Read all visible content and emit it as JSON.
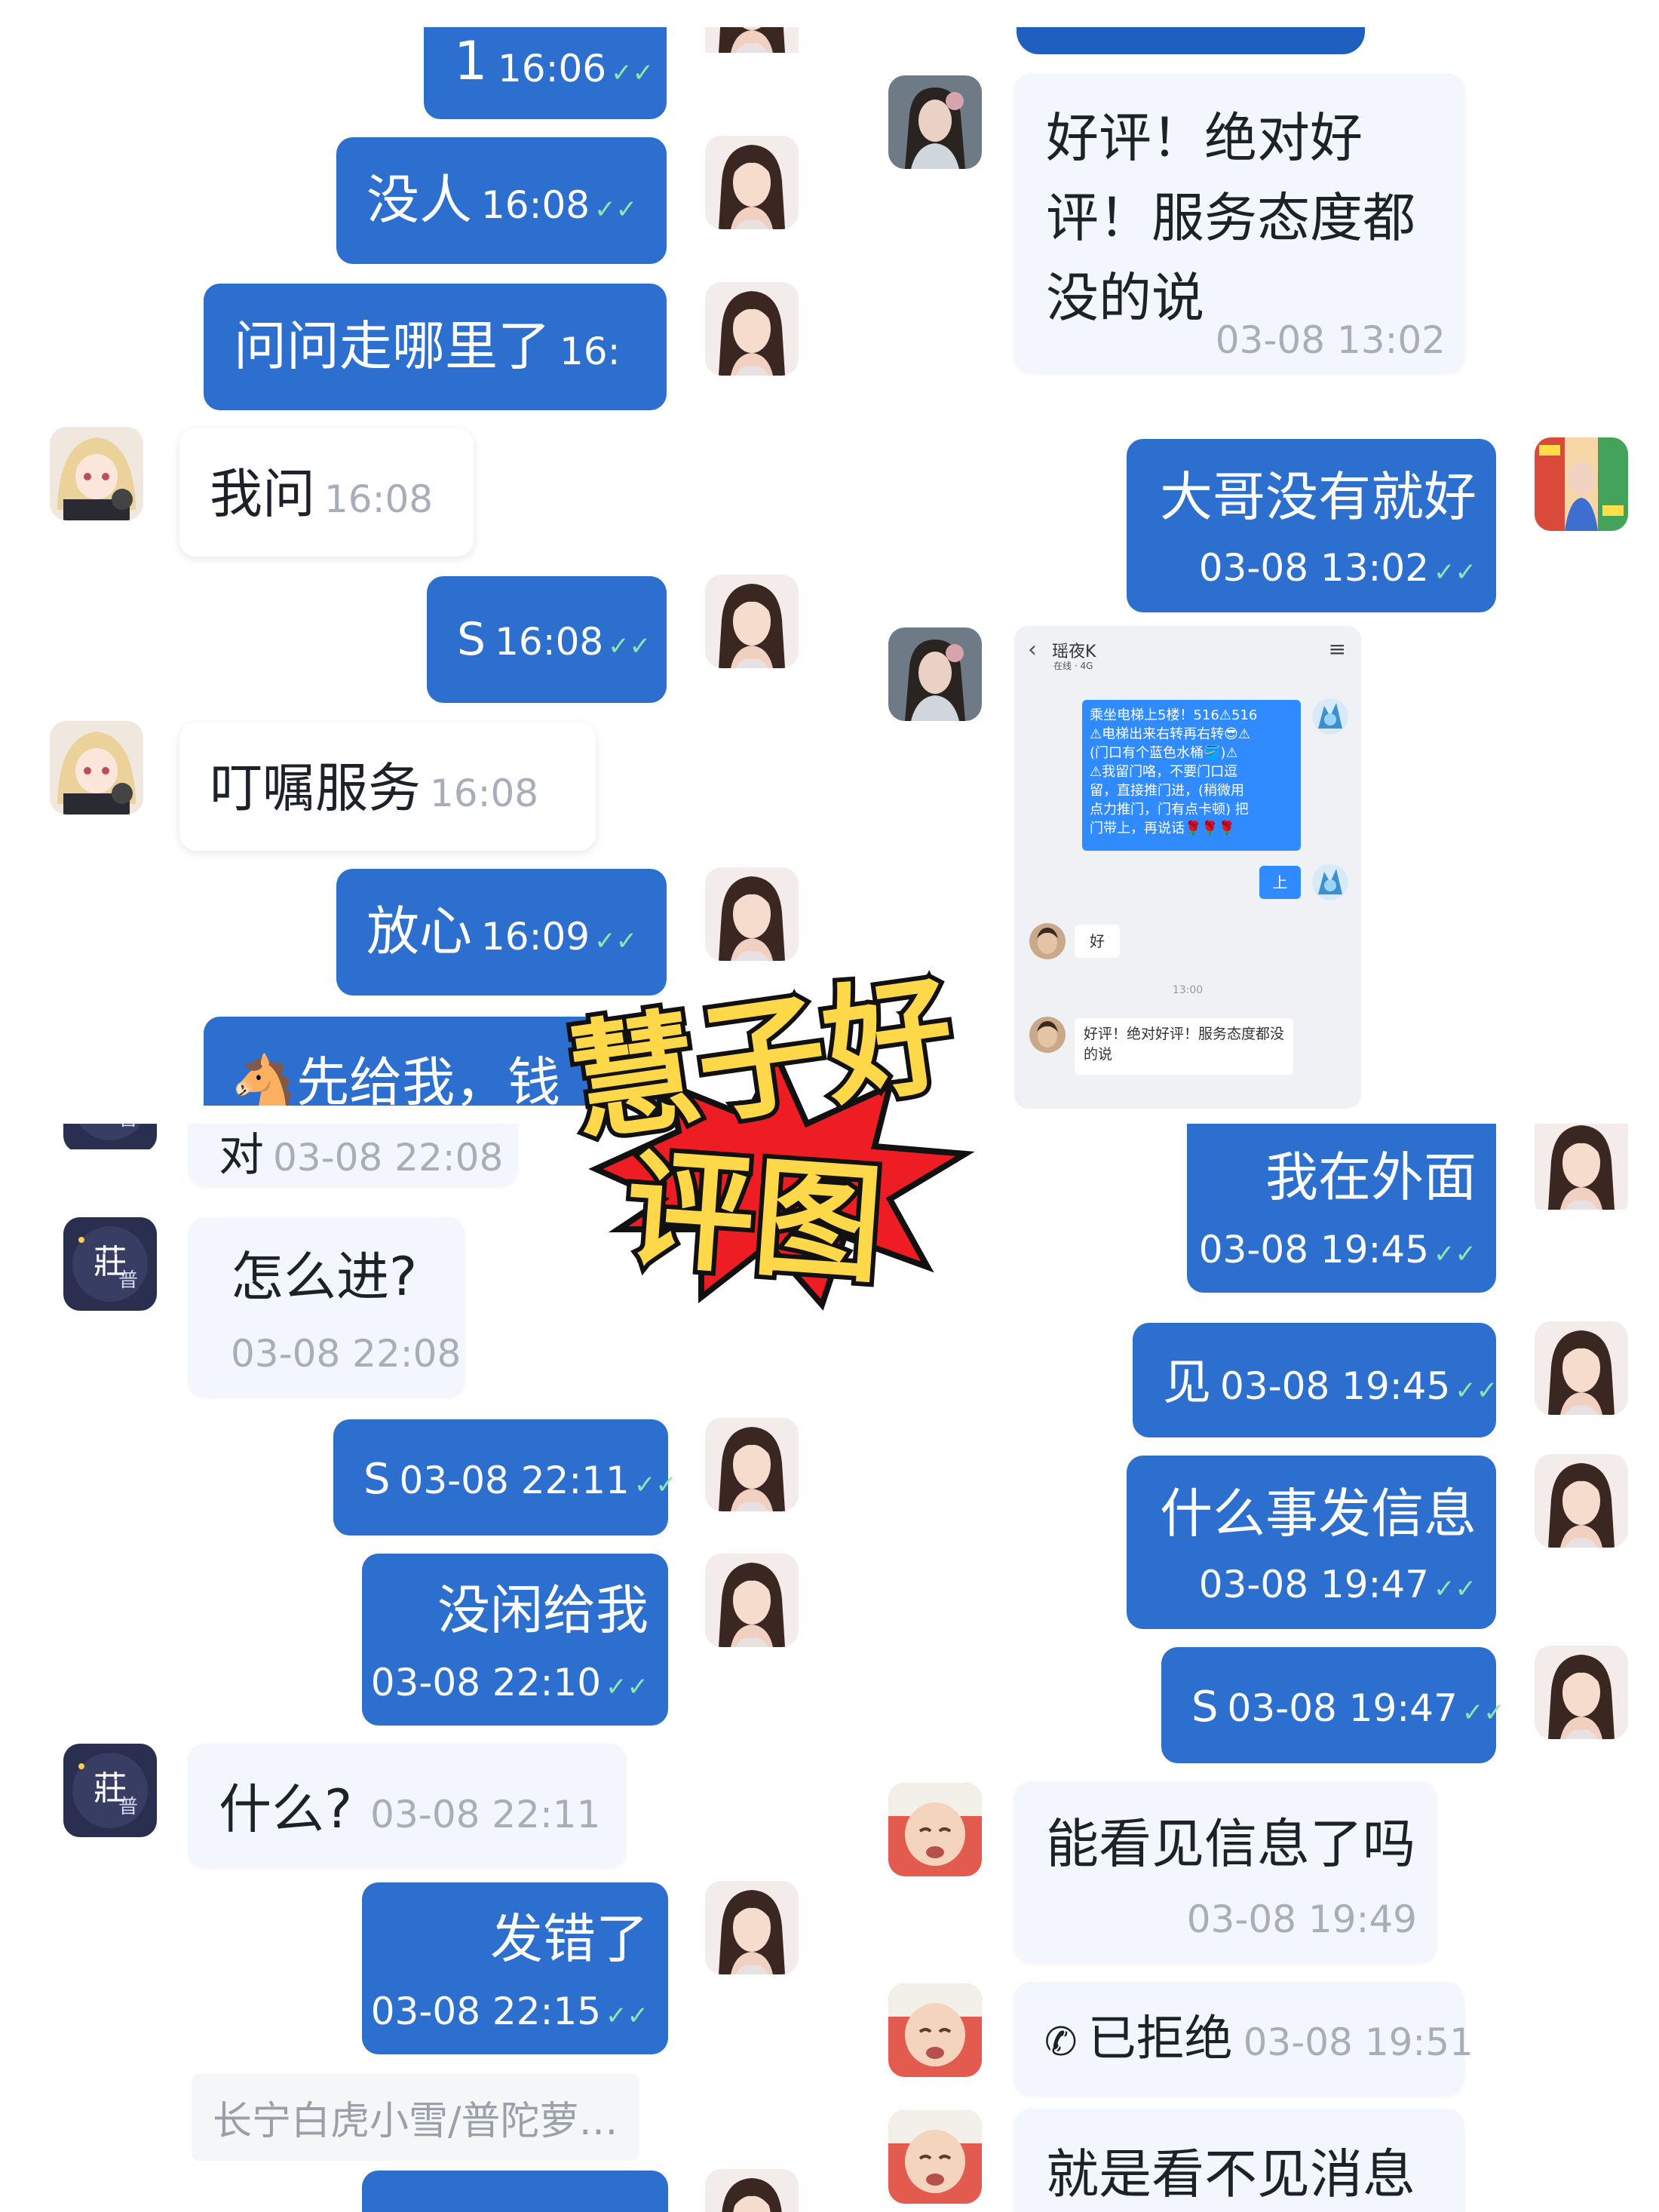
{
  "overlay": {
    "line1": "慧子好",
    "line2": "评图"
  },
  "top_left": {
    "messages": [
      {
        "text": "1",
        "time": "16:06"
      },
      {
        "text": "没人",
        "time": "16:08"
      },
      {
        "text": "问问走哪里了",
        "time": "16:"
      },
      {
        "text": "我问",
        "time": "16:08"
      },
      {
        "text": "S",
        "time": "16:08"
      },
      {
        "text": "叮嘱服务",
        "time": "16:08"
      },
      {
        "text": "放心",
        "time": "16:09"
      },
      {
        "text": "🐴先给我，钱"
      }
    ]
  },
  "top_right": {
    "messages": [
      {
        "text1": "好评！绝对好",
        "text2": "评！服务态度都",
        "text3": "没的说",
        "time": "03-08 13:02"
      },
      {
        "text": "大哥没有就好",
        "time": "03-08 13:02"
      }
    ],
    "screenshot": {
      "contact_name": "瑶夜K",
      "status": "在线 · 4G",
      "bubble": "乘坐电梯上5楼！516⚠516\n⚠电梯出来右转再右转😎⚠\n(门口有个蓝色水桶🪣)⚠\n⚠我留门咯，不要门口逗\n留，直接推门进，(稍微用\n点力推门，门有点卡顿) 把\n门带上，再说话🌹🌹🌹",
      "reply_up": "上",
      "reply_ok": "好",
      "time_divider": "13:00",
      "review": "好评！绝对好评！服务态度都没的说"
    }
  },
  "bottom_left": {
    "messages": [
      {
        "text": "对",
        "time": "03-08 22:08"
      },
      {
        "text": "怎么进?",
        "time": "03-08 22:08"
      },
      {
        "text": "S",
        "time": "03-08 22:11"
      },
      {
        "text": "没闲给我",
        "time": "03-08 22:10"
      },
      {
        "text": "什么?",
        "time": "03-08 22:11"
      },
      {
        "text": "发错了",
        "time": "03-08 22:15"
      }
    ],
    "system_note": "长宁白虎小雪/普陀萝…"
  },
  "bottom_right": {
    "messages": [
      {
        "text": "我在外面",
        "time": "03-08 19:45"
      },
      {
        "text": "见",
        "time": "03-08 19:45"
      },
      {
        "text": "什么事发信息",
        "time": "03-08 19:47"
      },
      {
        "text": "S",
        "time": "03-08 19:47"
      },
      {
        "text": "能看见信息了吗",
        "time": "03-08 19:49"
      },
      {
        "text": "已拒绝",
        "time": "03-08 19:51",
        "icon": "phone-icon"
      },
      {
        "text": "就是看不见消息"
      }
    ]
  }
}
